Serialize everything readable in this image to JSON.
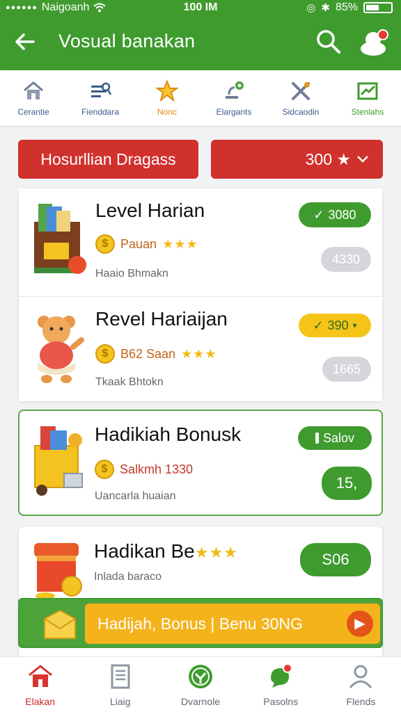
{
  "status_bar": {
    "carrier": "Naigoanh",
    "time": "100 IM",
    "battery": "85%"
  },
  "header": {
    "title": "Vosual banakan"
  },
  "categories": [
    {
      "label": "Cerantie",
      "icon": "home-icon"
    },
    {
      "label": "Fienddara",
      "icon": "tools-icon"
    },
    {
      "label": "Nonc",
      "icon": "star-icon"
    },
    {
      "label": "Elargants",
      "icon": "lamp-icon"
    },
    {
      "label": "Sidcaodin",
      "icon": "wrench-icon"
    },
    {
      "label": "Stenlahs",
      "icon": "chart-icon"
    }
  ],
  "filter": {
    "label": "Hosurllian Dragass",
    "points_label": "300 ★"
  },
  "rewards": [
    {
      "title": "Level Harian",
      "reward_text": "Pauan",
      "stars": "★★★",
      "subtitle": "Haaio Bhmakn",
      "primary_badge": "3080",
      "secondary_badge": "4330"
    },
    {
      "title": "Revel Hariaijan",
      "reward_text": "B62 Saan",
      "stars": "★★★",
      "subtitle": "Tkaak Bhtokn",
      "primary_badge": "390",
      "secondary_badge": "1665"
    },
    {
      "title": "Hadikiah Bonusk",
      "reward_text": "Salkmh 1330",
      "subtitle": "Uancarla huaian",
      "primary_badge": "Salov",
      "secondary_badge": "15,"
    },
    {
      "title": "Hadikan Be",
      "stars": "★★★",
      "subtitle": "Inlada baraco",
      "primary_badge": "S06"
    }
  ],
  "promo": {
    "label": "Hadijah, Bonus | Benu 30NG"
  },
  "bottom_nav": [
    {
      "label": "Elakan",
      "icon": "home-icon"
    },
    {
      "label": "Liaig",
      "icon": "document-icon"
    },
    {
      "label": "Dvarnole",
      "icon": "badge-icon"
    },
    {
      "label": "Pasolns",
      "icon": "chat-icon"
    },
    {
      "label": "Flends",
      "icon": "person-icon"
    }
  ],
  "colors": {
    "brand_green": "#3f9b2e",
    "accent_red": "#d0312d",
    "accent_yellow": "#f6c419"
  }
}
